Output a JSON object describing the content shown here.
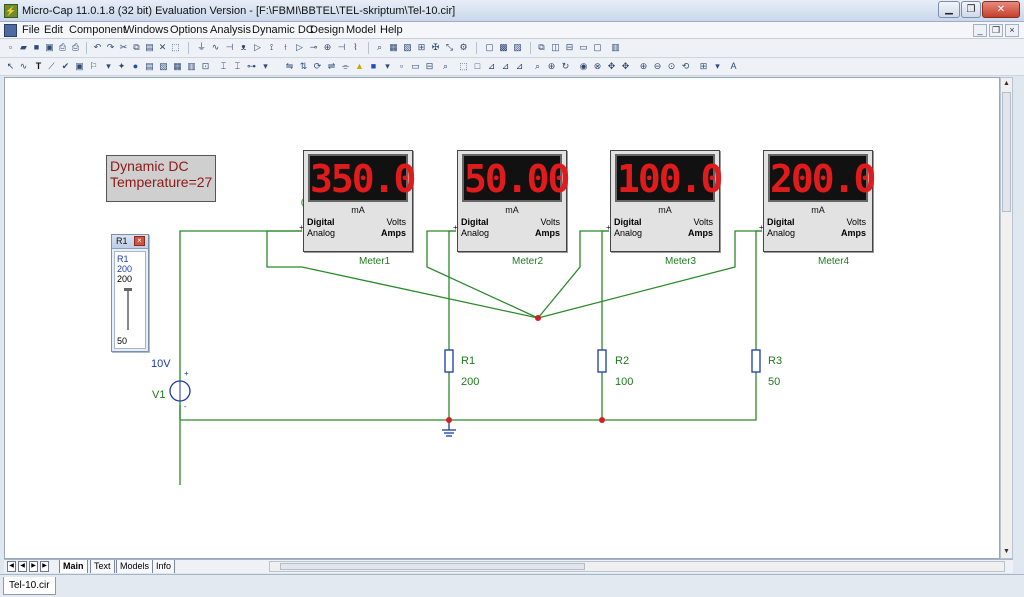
{
  "window": {
    "title": "Micro-Cap 11.0.1.8 (32 bit) Evaluation Version - [F:\\FBMI\\BBTEL\\TEL-skriptum\\Tel-10.cir]"
  },
  "menu": [
    "File",
    "Edit",
    "Component",
    "Windows",
    "Options",
    "Analysis",
    "Dynamic DC",
    "Design",
    "Model",
    "Help"
  ],
  "schematic": {
    "analysis_box": {
      "line1": "Dynamic DC",
      "line2": "Temperature=27"
    },
    "node_label": "0",
    "slider": {
      "title": "R1",
      "name": "R1",
      "value": "200",
      "current": "200",
      "min": "50"
    },
    "meters": [
      {
        "value": "350.0",
        "unit": "mA",
        "mode_top": "Digital",
        "mode_bottom": "Analog",
        "type_top": "Volts",
        "type_bottom": "Amps",
        "name": "Meter1"
      },
      {
        "value": "50.00",
        "unit": "mA",
        "mode_top": "Digital",
        "mode_bottom": "Analog",
        "type_top": "Volts",
        "type_bottom": "Amps",
        "name": "Meter2"
      },
      {
        "value": "100.0",
        "unit": "mA",
        "mode_top": "Digital",
        "mode_bottom": "Analog",
        "type_top": "Volts",
        "type_bottom": "Amps",
        "name": "Meter3"
      },
      {
        "value": "200.0",
        "unit": "mA",
        "mode_top": "Digital",
        "mode_bottom": "Analog",
        "type_top": "Volts",
        "type_bottom": "Amps",
        "name": "Meter4"
      }
    ],
    "source": {
      "name": "V1",
      "value": "10V"
    },
    "resistors": [
      {
        "name": "R1",
        "value": "200"
      },
      {
        "name": "R2",
        "value": "100"
      },
      {
        "name": "R3",
        "value": "50"
      }
    ],
    "wire_color": "#2a8a2a",
    "node_color": "#d21f1f",
    "component_color": "#1b3aa8"
  },
  "sheet_tabs": [
    "Main",
    "Text",
    "Models",
    "Info"
  ],
  "document_tab": "Tel-10.cir"
}
